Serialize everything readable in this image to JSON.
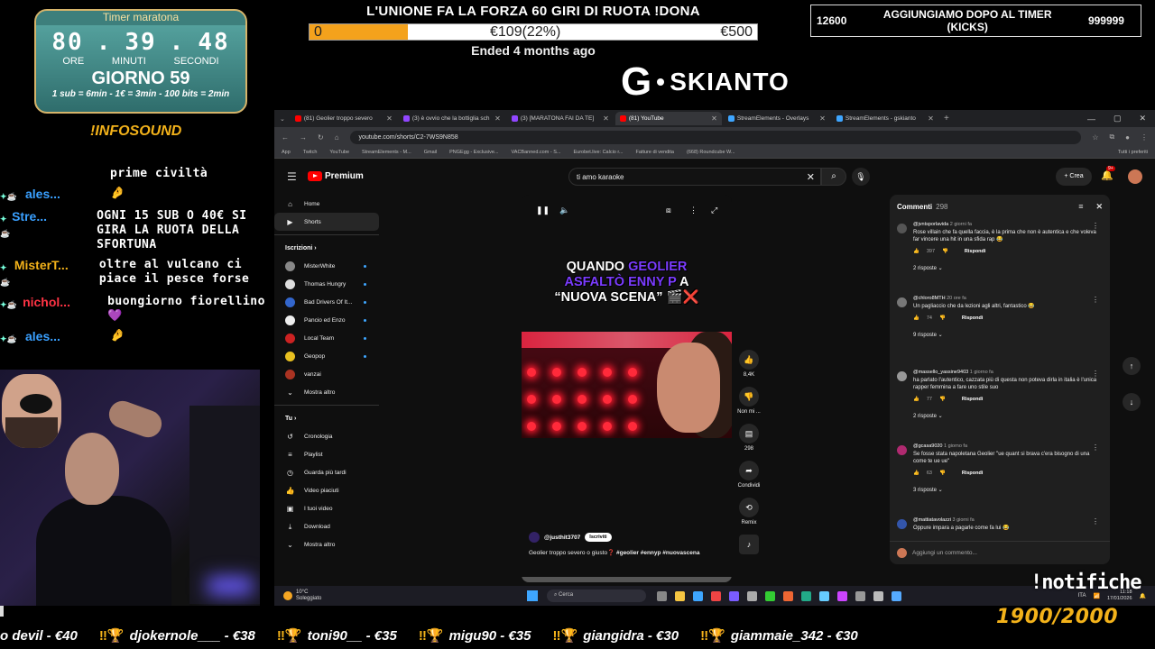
{
  "timer": {
    "title": "Timer maratona",
    "hours": "80",
    "minutes": "39",
    "seconds": "48",
    "sep1": ".",
    "sep2": ".",
    "unit_hours": "ORE",
    "unit_minutes": "MINUTI",
    "unit_seconds": "SECONDI",
    "day": "GIORNO 59",
    "rates": "1 sub = 6min - 1€ = 3min - 100 bits = 2min"
  },
  "infosound": "!INFOSOUND",
  "chat": [
    {
      "user": "",
      "msg": "prime civiltà",
      "color": "#ffffff"
    },
    {
      "user": "ales...",
      "msg": "🤌",
      "color": "#3aa0ff"
    },
    {
      "user": "Stre...",
      "msg": "OGNI 15 SUB O 40€ SI GIRA LA RUOTA DELLA SFORTUNA",
      "color": "#3aa0ff"
    },
    {
      "user": "MisterT...",
      "msg": "oltre al vulcano ci piace il pesce forse",
      "color": "#f3b21a"
    },
    {
      "user": "nichol...",
      "msg": "buongiorno fiorellino 💜",
      "color": "#ff3344"
    },
    {
      "user": "ales...",
      "msg": "🤌",
      "color": "#3aa0ff"
    }
  ],
  "goal": {
    "title": "L'UNIONE FA LA FORZA 60 GIRI DI RUOTA !DONA",
    "start": "0",
    "current": "€109(22%)",
    "target": "€500",
    "progress": 0.22,
    "ended": "Ended 4 months ago"
  },
  "kicks": {
    "left": "12600",
    "label": "AGGIUNGIAMO DOPO AL TIMER (KICKS)",
    "right": "999999"
  },
  "logo": {
    "letter": "G",
    "name": "SKIANTO"
  },
  "browser": {
    "tabs": [
      {
        "label": "(81) Geolier troppo severo",
        "color": "#ff0000",
        "active": false
      },
      {
        "label": "(3) è ovvio che la bottiglia sch",
        "color": "#9146ff",
        "active": false
      },
      {
        "label": "(3) [MARATONA FAI DA TE]",
        "color": "#9146ff",
        "active": false
      },
      {
        "label": "(81) YouTube",
        "color": "#ff0000",
        "active": true
      },
      {
        "label": "StreamElements - Overlays",
        "color": "#3ea6ff",
        "active": false
      },
      {
        "label": "StreamElements - gskianto",
        "color": "#3ea6ff",
        "active": false
      }
    ],
    "newtab": "+",
    "url": "youtube.com/shorts/C2-7WS9N858",
    "bookmarks": [
      "App",
      "Twitch",
      "YouTube",
      "StreamElements - M...",
      "Gmail",
      "PNGEgg - Exclusive...",
      "VACBanned.com - S...",
      "Eurobet.live: Calcio r...",
      "Fatture di vendita",
      "(668) Roundcube W..."
    ],
    "bookmarks_right": "Tutti i preferiti"
  },
  "youtube": {
    "brand": "Premium",
    "search_value": "ti amo karaoke",
    "create": "+ Crea",
    "notif_badge": "9+",
    "sidebar_main": [
      {
        "label": "Home",
        "icon": "⌂",
        "selected": false
      },
      {
        "label": "Shorts",
        "icon": "▶",
        "selected": true
      }
    ],
    "subs_header": "Iscrizioni",
    "subs": [
      {
        "label": "MisterWhite",
        "color": "#888",
        "dot": true
      },
      {
        "label": "Thomas Hungry",
        "color": "#ddd",
        "dot": true
      },
      {
        "label": "Bad Drivers Of It...",
        "color": "#3366cc",
        "dot": true
      },
      {
        "label": "Pancio ed Enzo",
        "color": "#eee",
        "dot": true
      },
      {
        "label": "Local Team",
        "color": "#cc2222",
        "dot": true
      },
      {
        "label": "Geopop",
        "color": "#e8c020",
        "dot": true
      },
      {
        "label": "vanzai",
        "color": "#aa3322",
        "dot": false
      }
    ],
    "show_more": "Mostra altro",
    "you_header": "Tu",
    "you_items": [
      {
        "label": "Cronologia",
        "icon": "↺"
      },
      {
        "label": "Playlist",
        "icon": "≡"
      },
      {
        "label": "Guarda più tardi",
        "icon": "◷"
      },
      {
        "label": "Video piaciuti",
        "icon": "👍"
      },
      {
        "label": "I tuoi video",
        "icon": "▣"
      },
      {
        "label": "Download",
        "icon": "⤓"
      }
    ],
    "show_more2": "Mostra altro",
    "short": {
      "caption_1": "QUANDO ",
      "caption_geolier": "GEOLIER",
      "caption_2": "ASFALTÒ ENNY P",
      "caption_3": " A",
      "caption_4": "“NUOVA SCENA”",
      "caption_emoji": "🎬❌",
      "channel": "@justhit3707",
      "subscribe": "Iscriviti",
      "description": "Geolier troppo severo o giusto",
      "question": "❓",
      "tags": "#geolier #ennyp #nuovascena",
      "likes": "8,4K",
      "dislike": "Non mi ...",
      "comments": "298",
      "share": "Condividi",
      "remix": "Remix"
    },
    "comments_title": "Commenti",
    "comments_count": "298",
    "comments": [
      {
        "user": "@jvntsporlavida",
        "time": "2 giorni fa",
        "text": "Rose villain che fa quella faccia, è la prima che non è autentica e che voleva far vincere una hit in una sfida rap 😂",
        "likes": "397",
        "replies": "2 risposte",
        "color": "#555"
      },
      {
        "user": "@chloro8MTH",
        "time": "20 ore fa",
        "text": "Un pagliaccio che da lezioni agli altri, fantastico 😂",
        "likes": "74",
        "replies": "9 risposte",
        "color": "#777"
      },
      {
        "user": "@massello_yassine9403",
        "time": "1 giorno fa",
        "text": "ha parlato l'autentico, cazzata più di questa non poteva dirla in italia è l'unica rapper femmina a fare uno stile suo",
        "likes": "77",
        "replies": "2 risposte",
        "color": "#999"
      },
      {
        "user": "@gcasa9020",
        "time": "1 giorno fa",
        "text": "Se fosse stata napoletana Geolier \"ue quant si brava c'era bisogno di una come te ue ue\"",
        "likes": "63",
        "replies": "3 risposte",
        "color": "#b02a70"
      },
      {
        "user": "@mattiatavolazzi",
        "time": "3 giorni fa",
        "text": "Oppure impara a pagarle come fa lui 😂",
        "likes": "",
        "replies": "",
        "color": "#3355aa"
      }
    ],
    "reply_label": "Rispondi",
    "add_comment": "Aggiungi un commento..."
  },
  "taskbar": {
    "temp": "10°C",
    "weather": "Soleggiato",
    "search": "Cerca",
    "lang": "ITA",
    "time": "11:18",
    "date": "17/01/2026"
  },
  "notifiche": "!notifiche",
  "counter": "1900/2000",
  "ticker": [
    "o devil - €40",
    "djokernole___ - €38",
    "toni90__ - €35",
    "migu90 - €35",
    "giangidra - €30",
    "giammaie_342 - €30"
  ]
}
